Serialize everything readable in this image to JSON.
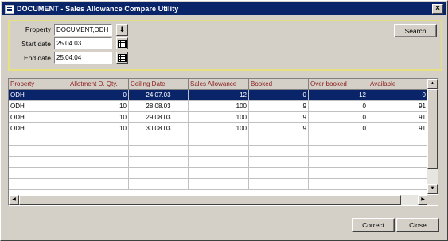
{
  "window": {
    "title": "DOCUMENT - Sales Allowance Compare Utility",
    "close_glyph": "×"
  },
  "filters": {
    "property_label": "Property",
    "property_value": "DOCUMENT,ODH",
    "start_label": "Start date",
    "start_value": "25.04.03",
    "end_label": "End date",
    "end_value": "25.04.04"
  },
  "buttons": {
    "search": "Search",
    "correct": "Correct",
    "close": "Close"
  },
  "grid": {
    "columns": [
      "Property",
      "Allotment D. Qty.",
      "Ceiling Date",
      "Sales Allowance",
      "Booked",
      "Over booked",
      "Available"
    ],
    "rows": [
      [
        "ODH",
        "0",
        "24.07.03",
        "12",
        "0",
        "12",
        "0"
      ],
      [
        "ODH",
        "10",
        "28.08.03",
        "100",
        "9",
        "0",
        "91"
      ],
      [
        "ODH",
        "10",
        "29.08.03",
        "100",
        "9",
        "0",
        "91"
      ],
      [
        "ODH",
        "10",
        "30.08.03",
        "100",
        "9",
        "0",
        "91"
      ]
    ],
    "selected_row": 0
  },
  "colors": {
    "title_bar": "#0a246a",
    "selection": "#0a246a",
    "header_text": "#8b1a1a",
    "panel_border": "#e6e080"
  },
  "icons": {
    "property_lookup": "download-arrow-icon",
    "start_calendar": "calendar-icon",
    "end_calendar": "calendar-icon"
  }
}
